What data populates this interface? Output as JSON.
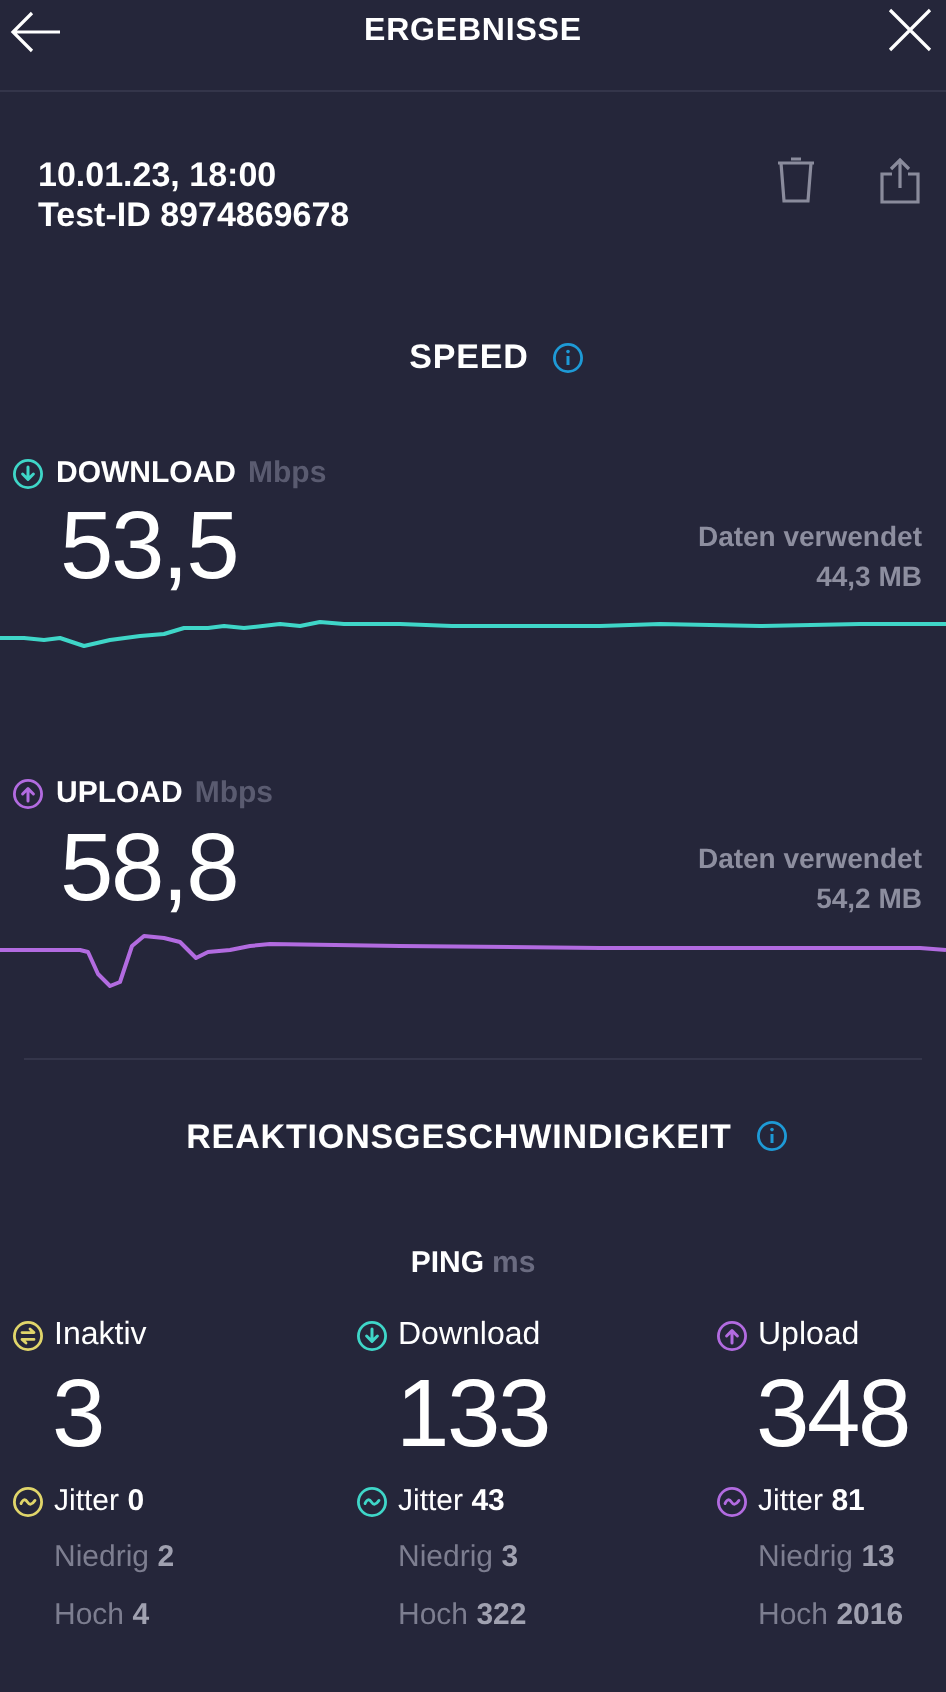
{
  "header": {
    "title": "ERGEBNISSE"
  },
  "test": {
    "date": "10.01.23, 18:00",
    "id": "Test-ID 8974869678"
  },
  "speed": {
    "title": "SPEED",
    "tests": [
      {
        "kind": "download",
        "color": "#3fd6c8",
        "label": "DOWNLOAD",
        "unit": "Mbps",
        "value": "53,5",
        "data_label": "Daten verwendet",
        "data_value": "44,3 MB"
      },
      {
        "kind": "upload",
        "color": "#b26be0",
        "label": "UPLOAD",
        "unit": "Mbps",
        "value": "58,8",
        "data_label": "Daten verwendet",
        "data_value": "54,2 MB"
      }
    ]
  },
  "reaction": {
    "title": "REAKTIONSGESCHWINDIGKEIT",
    "ping_label": "PING",
    "ping_unit": "ms",
    "columns": [
      {
        "kind": "idle",
        "color": "#e0d56a",
        "label": "Inaktiv",
        "value": "3",
        "jitter": "Jitter **0**",
        "low": "Niedrig **2**",
        "high": "Hoch **4**"
      },
      {
        "kind": "download",
        "color": "#3fd6c8",
        "label": "Download",
        "value": "133",
        "jitter": "Jitter **43**",
        "low": "Niedrig **3**",
        "high": "Hoch **322**"
      },
      {
        "kind": "upload",
        "color": "#b26be0",
        "label": "Upload",
        "value": "348",
        "jitter": "Jitter **81**",
        "low": "Niedrig **13**",
        "high": "Hoch **2016**"
      }
    ]
  }
}
